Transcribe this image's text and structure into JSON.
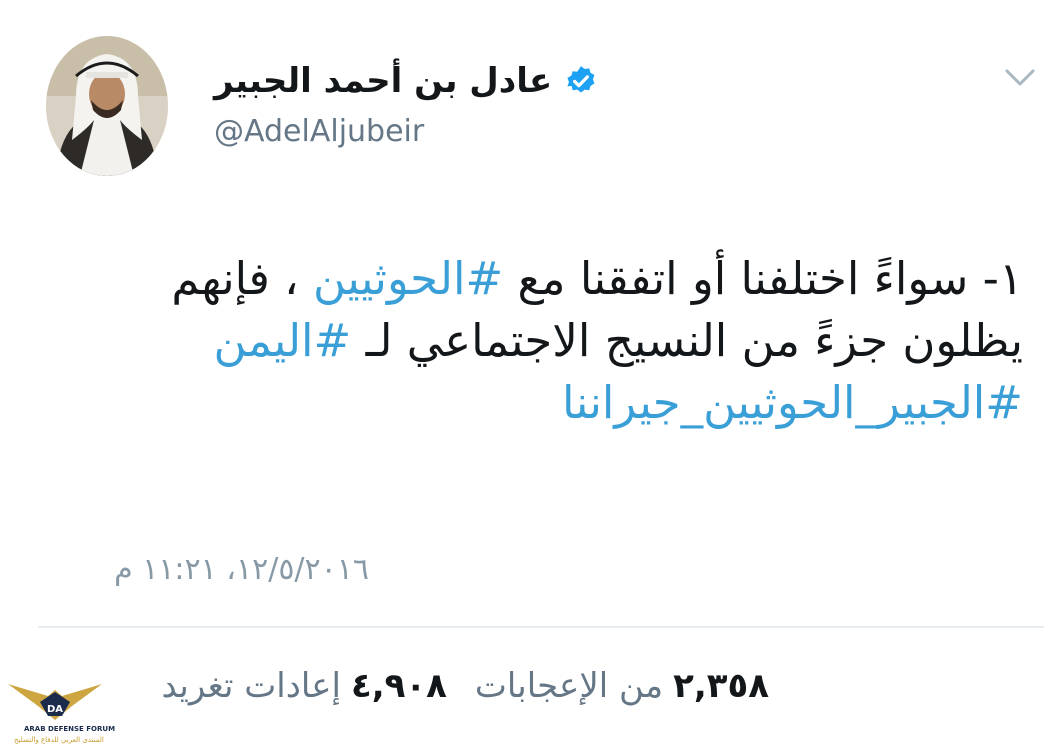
{
  "tweet": {
    "display_name": "عادل بن أحمد الجبير",
    "handle": "@AdelAljubeir",
    "text_line1_a": "١- سواءً اختلفنا أو اتفقنا مع ",
    "hashtag1": "#الحوثيين",
    "text_line1_b": " ، فإنهم",
    "text_line2_a": "يظلون جزءً من النسيج الاجتماعي لـ ",
    "hashtag2": "#اليمن",
    "hashtag3": "#الجبير_الحوثيين_جيراننا",
    "timestamp": "١٢/٥/٢٠١٦، ١١:٢١ م",
    "retweets_count": "٢,٣٥٨",
    "retweets_label": "من الإعجابات",
    "likes_count": "٤,٩٠٨",
    "likes_label": "إعادات تغريد"
  },
  "watermark": {
    "logo_text": "DA",
    "title": "ARAB DEFENSE FORUM",
    "subtitle": "المنتدى العربي للدفاع والتسليح"
  },
  "colors": {
    "hashtag": "#3a9fd6",
    "verified": "#1da1f2",
    "muted": "#657786",
    "divider": "#e6ecf0"
  },
  "icons": {
    "verified": "verified-badge-icon",
    "menu": "chevron-down-icon"
  }
}
